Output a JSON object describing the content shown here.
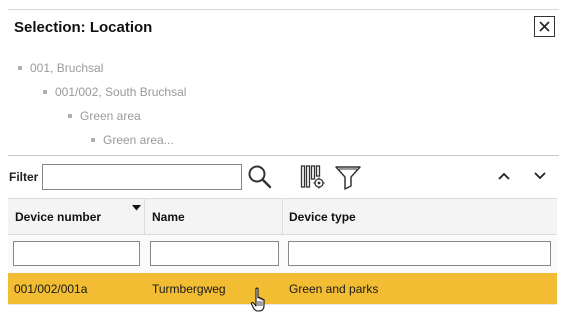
{
  "dialog": {
    "title": "Selection: Location",
    "close_icon": "close-icon"
  },
  "breadcrumb_tree": [
    {
      "label": "001, Bruchsal",
      "level": 0
    },
    {
      "label": "001/002, South Bruchsal",
      "level": 1
    },
    {
      "label": "Green area",
      "level": 2
    },
    {
      "label": "Green area...",
      "level": 3
    }
  ],
  "toolbar": {
    "filter_label": "Filter",
    "filter_value": "",
    "search_icon": "search-icon",
    "column_settings_icon": "column-settings-icon",
    "funnel_icon": "filter-funnel-icon",
    "collapse_icon": "chevron-up-icon",
    "expand_icon": "chevron-down-icon"
  },
  "table": {
    "columns": [
      {
        "label": "Device number",
        "sorted": "descending"
      },
      {
        "label": "Name"
      },
      {
        "label": "Device type"
      }
    ],
    "column_filters": [
      "",
      "",
      ""
    ],
    "rows": [
      {
        "device_number": "001/002/001a",
        "name": "Turmbergweg",
        "device_type": "Green and parks",
        "selected": true
      }
    ]
  },
  "colors": {
    "selected_row": "#f2bd32",
    "tree_text": "#9a9a9a"
  }
}
